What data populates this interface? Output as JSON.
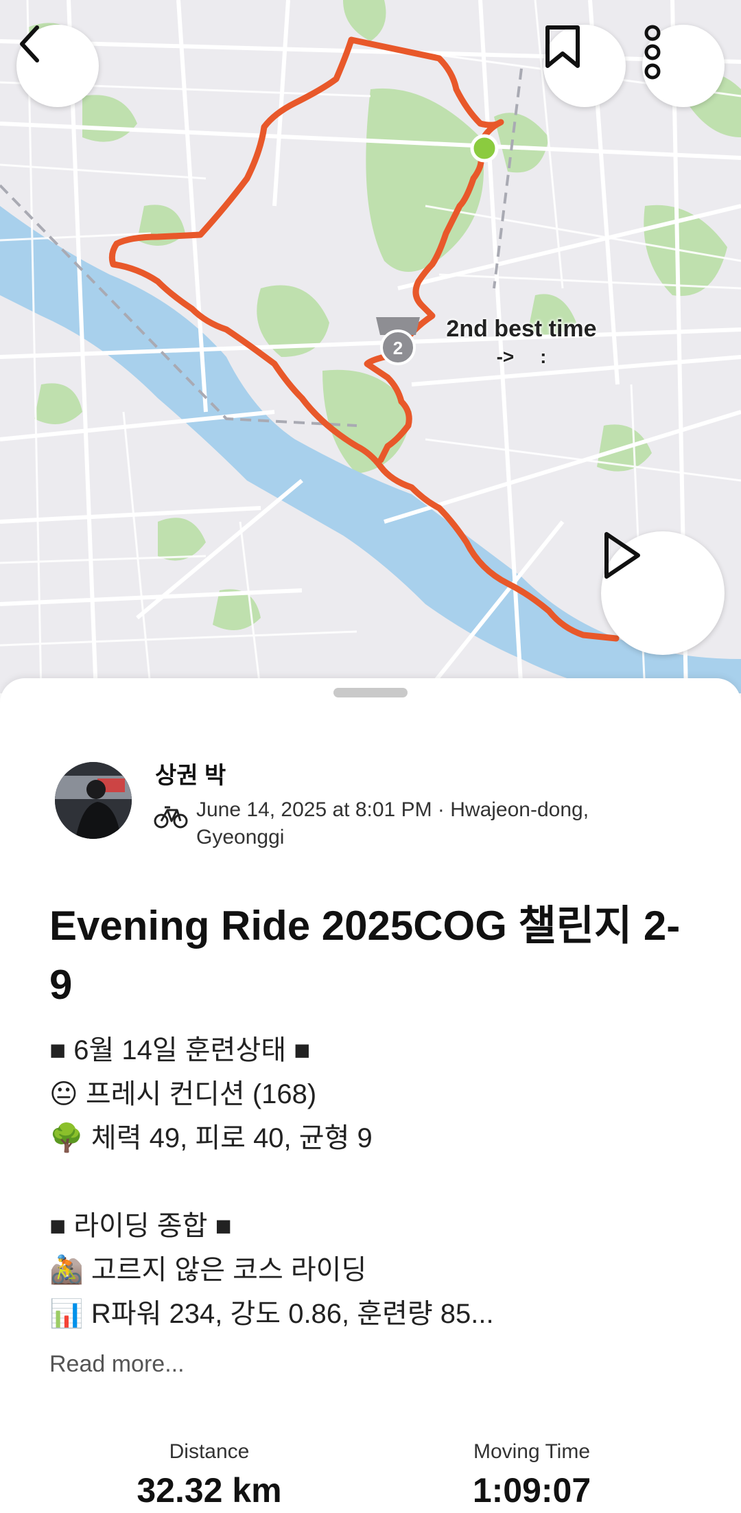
{
  "map": {
    "route_color": "#E8582A",
    "start_marker_color": "#8BCB3F",
    "segment_callout": {
      "title": "2nd best time",
      "subtitle": "->   :",
      "medal_rank": "2"
    }
  },
  "toolbar": {
    "back_icon": "chevron-left-icon",
    "bookmark_icon": "bookmark-icon",
    "more_icon": "more-vertical-icon",
    "play_icon": "play-icon"
  },
  "activity": {
    "athlete_name": "상권 박",
    "sport_icon": "bike-icon",
    "meta": "June 14, 2025 at 8:01 PM · Hwajeon-dong, Gyeonggi",
    "title": "Evening Ride 2025COG 챌린지 2-9",
    "description_lines": [
      "■ 6월 14일 훈련상태 ■",
      "😐 프레시 컨디션 (168)",
      "🌳 체력 49, 피로 40, 균형 9",
      "",
      "■ 라이딩 종합 ■",
      "🚵 고르지 않은 코스 라이딩",
      "📊 R파워 234, 강도 0.86, 훈련량 85..."
    ],
    "read_more": "Read more..."
  },
  "stats": {
    "distance_label": "Distance",
    "distance_value": "32.32 km",
    "moving_time_label": "Moving Time",
    "moving_time_value": "1:09:07"
  }
}
